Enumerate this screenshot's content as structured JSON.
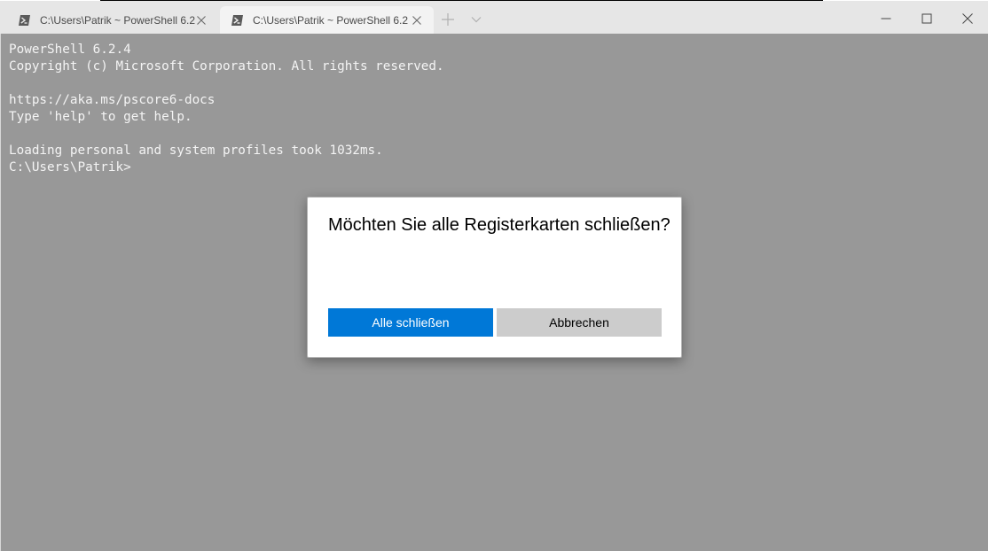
{
  "window": {
    "tabs": [
      {
        "title": "C:\\Users\\Patrik ~ PowerShell 6.2",
        "active": false
      },
      {
        "title": "C:\\Users\\Patrik ~ PowerShell 6.2",
        "active": true
      }
    ],
    "icons": {
      "tab": "powershell-icon",
      "tab_close": "close-icon",
      "new_tab": "plus-icon",
      "dropdown": "chevron-down-icon",
      "minimize": "minimize-icon",
      "maximize": "maximize-icon",
      "close": "close-icon"
    }
  },
  "terminal": {
    "lines": [
      "PowerShell 6.2.4",
      "Copyright (c) Microsoft Corporation. All rights reserved.",
      "",
      "https://aka.ms/pscore6-docs",
      "Type 'help' to get help.",
      "",
      "Loading personal and system profiles took 1032ms.",
      "C:\\Users\\Patrik>"
    ]
  },
  "dialog": {
    "title": "Möchten Sie alle Registerkarten schließen?",
    "confirm_label": "Alle schließen",
    "cancel_label": "Abbrechen"
  },
  "colors": {
    "accent": "#0078d7",
    "terminal_background": "#989898",
    "tabbar_background": "#e6e6e6"
  }
}
